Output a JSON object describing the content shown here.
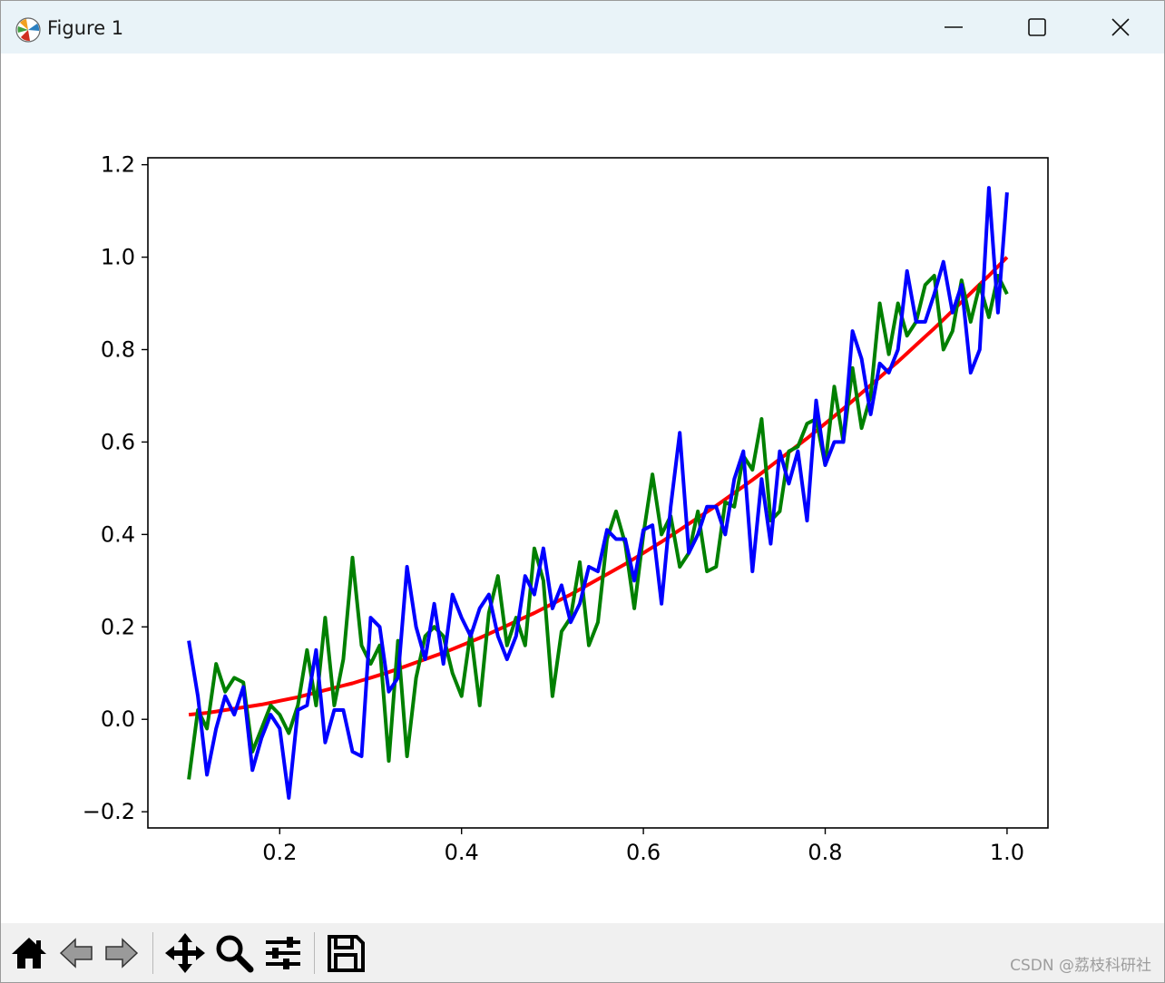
{
  "window": {
    "title": "Figure 1",
    "app_icon": "matplotlib-logo-icon",
    "controls": [
      "minimize-icon",
      "maximize-icon",
      "close-icon"
    ]
  },
  "toolbar": {
    "tools": [
      "home-icon",
      "back-arrow-icon",
      "forward-arrow-icon",
      "pan-move-icon",
      "zoom-magnifier-icon",
      "configure-subplots-icon",
      "save-disk-icon"
    ]
  },
  "watermark": "CSDN @荔枝科研社",
  "chart_data": {
    "type": "line",
    "title": "",
    "xlabel": "",
    "ylabel": "",
    "xlim": [
      0.055,
      1.045
    ],
    "ylim": [
      -0.235,
      1.215
    ],
    "xticks": [
      0.2,
      0.4,
      0.6,
      0.8,
      1.0
    ],
    "xtick_labels": [
      "0.2",
      "0.4",
      "0.6",
      "0.8",
      "1.0"
    ],
    "yticks": [
      -0.2,
      0.0,
      0.2,
      0.4,
      0.6,
      0.8,
      1.0,
      1.2
    ],
    "ytick_labels": [
      "−0.2",
      "0.0",
      "0.2",
      "0.4",
      "0.6",
      "0.8",
      "1.0",
      "1.2"
    ],
    "grid": false,
    "legend": "none",
    "x": [
      0.1,
      0.11,
      0.12,
      0.13,
      0.14,
      0.15,
      0.16,
      0.17,
      0.18,
      0.19,
      0.2,
      0.21,
      0.22,
      0.23,
      0.24,
      0.25,
      0.26,
      0.27,
      0.28,
      0.29,
      0.3,
      0.31,
      0.32,
      0.33,
      0.34,
      0.35,
      0.36,
      0.37,
      0.38,
      0.39,
      0.4,
      0.41,
      0.42,
      0.43,
      0.44,
      0.45,
      0.46,
      0.47,
      0.48,
      0.49,
      0.5,
      0.51,
      0.52,
      0.53,
      0.54,
      0.55,
      0.56,
      0.57,
      0.58,
      0.59,
      0.6,
      0.61,
      0.62,
      0.63,
      0.64,
      0.65,
      0.66,
      0.67,
      0.68,
      0.69,
      0.7,
      0.71,
      0.72,
      0.73,
      0.74,
      0.75,
      0.76,
      0.77,
      0.78,
      0.79,
      0.8,
      0.81,
      0.82,
      0.83,
      0.84,
      0.85,
      0.86,
      0.87,
      0.88,
      0.89,
      0.9,
      0.91,
      0.92,
      0.93,
      0.94,
      0.95,
      0.96,
      0.97,
      0.98,
      0.99,
      1.0
    ],
    "series": [
      {
        "color": "#ff0000",
        "values": [
          0.01,
          0.012,
          0.014,
          0.017,
          0.02,
          0.023,
          0.026,
          0.029,
          0.032,
          0.036,
          0.04,
          0.044,
          0.048,
          0.053,
          0.058,
          0.063,
          0.068,
          0.073,
          0.078,
          0.084,
          0.09,
          0.096,
          0.102,
          0.109,
          0.116,
          0.123,
          0.13,
          0.137,
          0.144,
          0.152,
          0.16,
          0.168,
          0.176,
          0.185,
          0.194,
          0.203,
          0.212,
          0.221,
          0.23,
          0.24,
          0.25,
          0.26,
          0.27,
          0.281,
          0.292,
          0.303,
          0.314,
          0.325,
          0.336,
          0.348,
          0.36,
          0.372,
          0.384,
          0.397,
          0.41,
          0.423,
          0.436,
          0.449,
          0.462,
          0.476,
          0.49,
          0.504,
          0.518,
          0.533,
          0.548,
          0.563,
          0.578,
          0.593,
          0.608,
          0.624,
          0.64,
          0.656,
          0.672,
          0.689,
          0.706,
          0.723,
          0.74,
          0.757,
          0.774,
          0.792,
          0.81,
          0.828,
          0.846,
          0.865,
          0.884,
          0.903,
          0.922,
          0.941,
          0.96,
          0.98,
          1.0
        ]
      },
      {
        "color": "#008000",
        "values": [
          -0.13,
          0.02,
          -0.02,
          0.12,
          0.06,
          0.09,
          0.08,
          -0.07,
          -0.02,
          0.03,
          0.01,
          -0.03,
          0.03,
          0.15,
          0.03,
          0.22,
          0.03,
          0.13,
          0.35,
          0.16,
          0.12,
          0.16,
          -0.09,
          0.17,
          -0.08,
          0.09,
          0.18,
          0.2,
          0.18,
          0.1,
          0.05,
          0.19,
          0.03,
          0.23,
          0.31,
          0.16,
          0.22,
          0.16,
          0.37,
          0.3,
          0.05,
          0.19,
          0.22,
          0.34,
          0.16,
          0.21,
          0.39,
          0.45,
          0.38,
          0.24,
          0.4,
          0.53,
          0.4,
          0.44,
          0.33,
          0.36,
          0.45,
          0.32,
          0.33,
          0.47,
          0.46,
          0.57,
          0.54,
          0.65,
          0.43,
          0.45,
          0.58,
          0.59,
          0.64,
          0.65,
          0.55,
          0.72,
          0.6,
          0.76,
          0.63,
          0.7,
          0.9,
          0.79,
          0.9,
          0.83,
          0.86,
          0.94,
          0.96,
          0.8,
          0.84,
          0.95,
          0.86,
          0.94,
          0.87,
          0.96,
          0.92
        ]
      },
      {
        "color": "#0000ff",
        "values": [
          0.17,
          0.05,
          -0.12,
          -0.02,
          0.05,
          0.01,
          0.07,
          -0.11,
          -0.04,
          0.01,
          -0.02,
          -0.17,
          0.02,
          0.03,
          0.15,
          -0.05,
          0.02,
          0.02,
          -0.07,
          -0.08,
          0.22,
          0.2,
          0.06,
          0.09,
          0.33,
          0.2,
          0.13,
          0.25,
          0.12,
          0.27,
          0.22,
          0.18,
          0.24,
          0.27,
          0.18,
          0.13,
          0.18,
          0.31,
          0.27,
          0.37,
          0.24,
          0.29,
          0.21,
          0.25,
          0.33,
          0.32,
          0.41,
          0.39,
          0.39,
          0.3,
          0.41,
          0.42,
          0.25,
          0.46,
          0.62,
          0.36,
          0.4,
          0.46,
          0.46,
          0.4,
          0.52,
          0.58,
          0.32,
          0.52,
          0.38,
          0.58,
          0.51,
          0.58,
          0.43,
          0.69,
          0.55,
          0.6,
          0.6,
          0.84,
          0.78,
          0.66,
          0.77,
          0.75,
          0.8,
          0.97,
          0.86,
          0.86,
          0.92,
          0.99,
          0.88,
          0.94,
          0.75,
          0.8,
          1.15,
          0.88,
          1.14
        ]
      }
    ]
  }
}
